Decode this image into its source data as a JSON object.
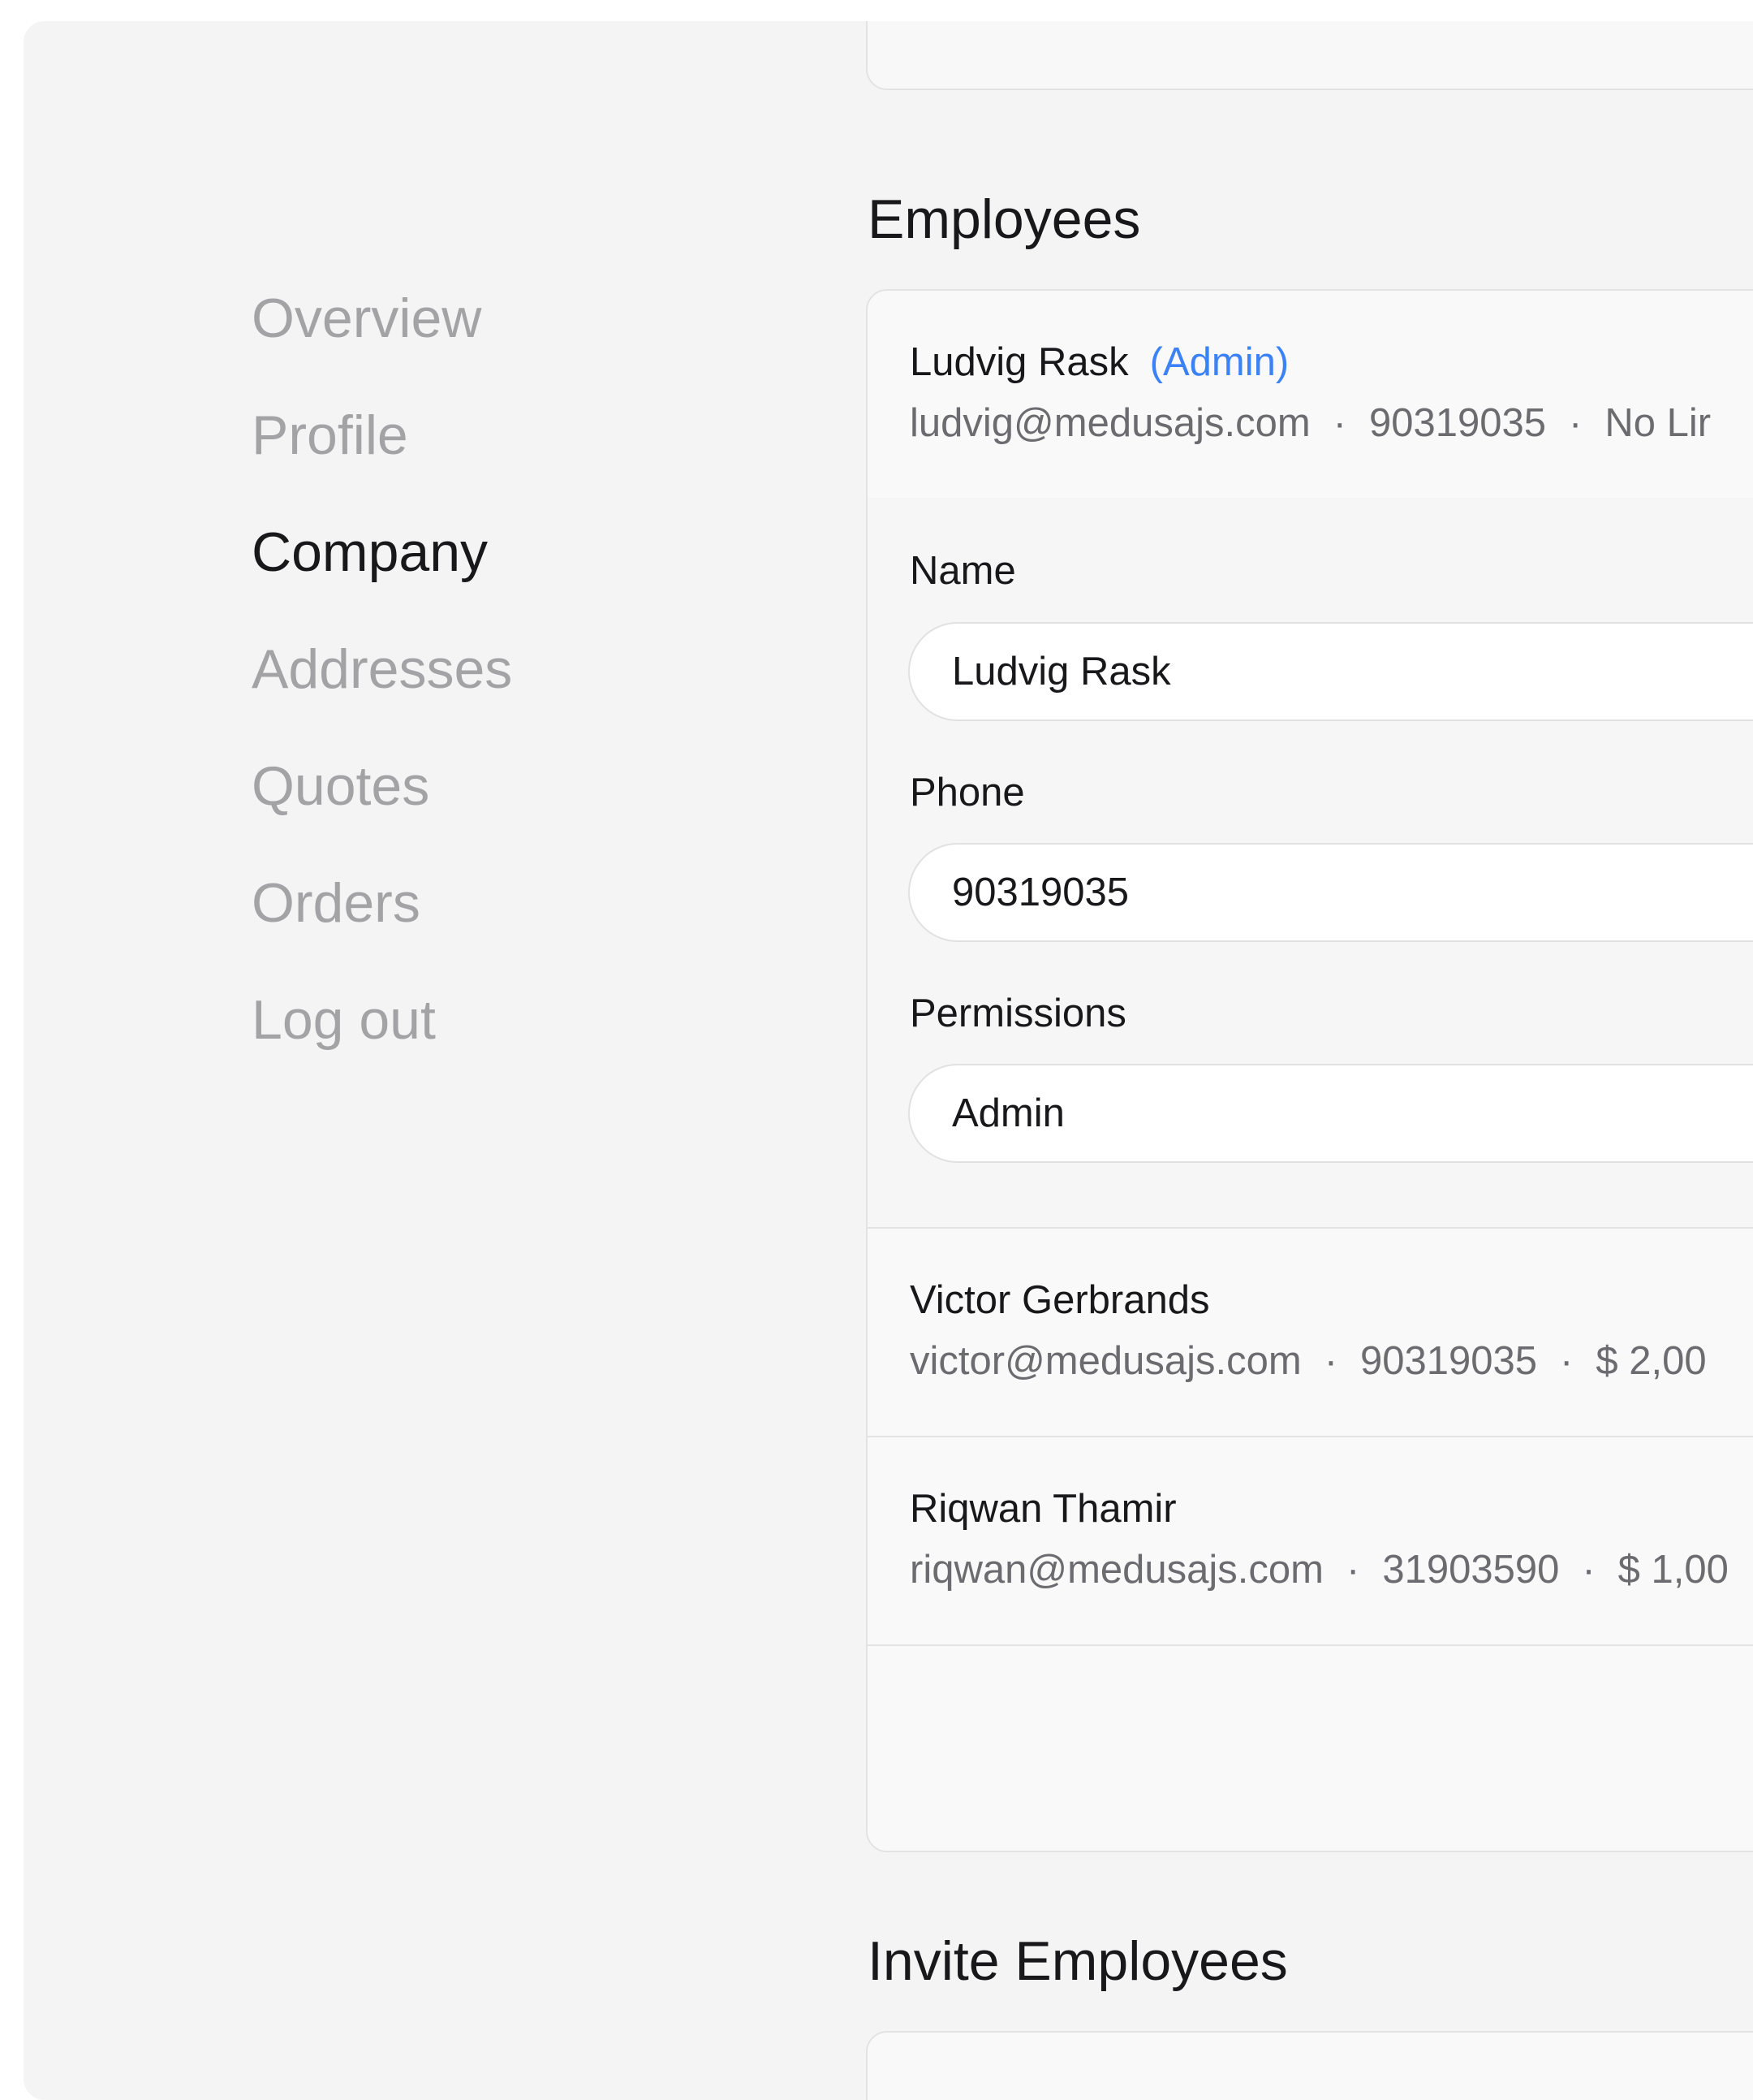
{
  "nav": {
    "items": [
      {
        "label": "Overview",
        "active": false
      },
      {
        "label": "Profile",
        "active": false
      },
      {
        "label": "Company",
        "active": true
      },
      {
        "label": "Addresses",
        "active": false
      },
      {
        "label": "Quotes",
        "active": false
      },
      {
        "label": "Orders",
        "active": false
      },
      {
        "label": "Log out",
        "active": false
      }
    ]
  },
  "employees": {
    "title": "Employees",
    "list": [
      {
        "name": "Ludvig Rask",
        "role": "(Admin)",
        "email": "ludvig@medusajs.com",
        "phone": "90319035",
        "limit": "No Lir",
        "expanded": true
      },
      {
        "name": "Victor Gerbrands",
        "email": "victor@medusajs.com",
        "phone": "90319035",
        "limit": "$ 2,00"
      },
      {
        "name": "Riqwan Thamir",
        "email": "riqwan@medusajs.com",
        "phone": "31903590",
        "limit": "$ 1,00"
      }
    ],
    "edit_form": {
      "name_label": "Name",
      "name_value": "Ludvig Rask",
      "phone_label": "Phone",
      "phone_value": "90319035",
      "permissions_label": "Permissions",
      "permissions_value": "Admin"
    },
    "separator": "·"
  },
  "invite": {
    "title": "Invite Employees"
  },
  "colors": {
    "background": "#f4f4f4",
    "text_active": "#18181b",
    "text_muted": "#a3a3a5",
    "meta_text": "#6b6b70",
    "accent": "#3b82f6"
  }
}
